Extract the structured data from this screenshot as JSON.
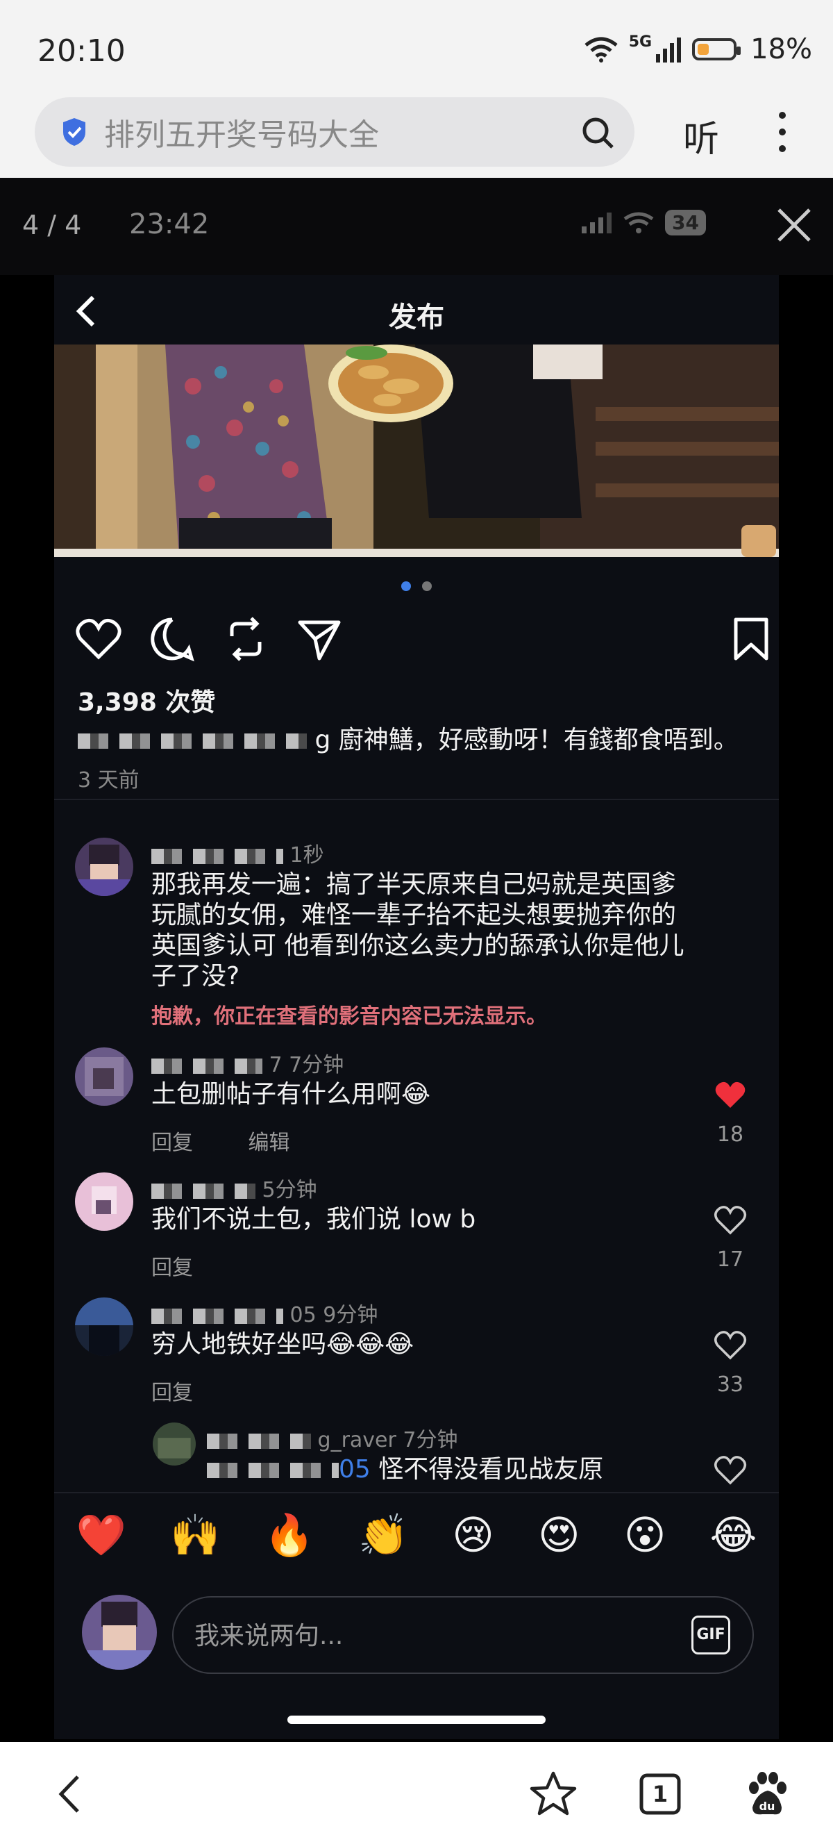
{
  "status_bar": {
    "time": "20:10",
    "network": "5G",
    "battery": "18%"
  },
  "browser": {
    "search_text": "排列五开奖号码大全",
    "listen_label": "听",
    "tab_count": "1"
  },
  "viewer": {
    "counter": "4 / 4",
    "inner_time": "23:42",
    "inner_battery": "34"
  },
  "post": {
    "title": "发布",
    "likes": "3,398 次赞",
    "caption_suffix": "g 廚神鱔，好感動呀！有錢都食唔到。",
    "posted_ago": "3 天前",
    "comments": [
      {
        "meta": "1秒",
        "text": "那我再发一遍：搞了半天原来自己妈就是英国爹玩腻的女佣，难怪一辈子抬不起头想要抛弃你的英国爹认可 他看到你这么卖力的舔承认你是他儿子了没?",
        "error": "抱歉，你正在查看的影音内容已无法显示。"
      },
      {
        "meta": "7 7分钟",
        "text": "土包删帖子有什么用啊😂",
        "reply": "回复",
        "edit": "编辑",
        "like_count": "18"
      },
      {
        "meta": "5分钟",
        "text": "我们不说土包，我们说 low b",
        "reply": "回复",
        "like_count": "17"
      },
      {
        "meta": "05 9分钟",
        "text": "穷人地铁好坐吗😂😂😂",
        "reply": "回复",
        "like_count": "33"
      },
      {
        "meta": "g_raver 7分钟",
        "mention": "05",
        "text": "怪不得没看见战友原"
      }
    ],
    "emojis": [
      "❤️",
      "🙌",
      "🔥",
      "👏",
      "😢",
      "😍",
      "😮",
      "😂"
    ],
    "input_placeholder": "我来说两句...",
    "gif_label": "GIF"
  },
  "colors": {
    "like_red": "#f0303c",
    "accent_blue": "#3f7fe8",
    "error_pink": "#e0707a"
  }
}
